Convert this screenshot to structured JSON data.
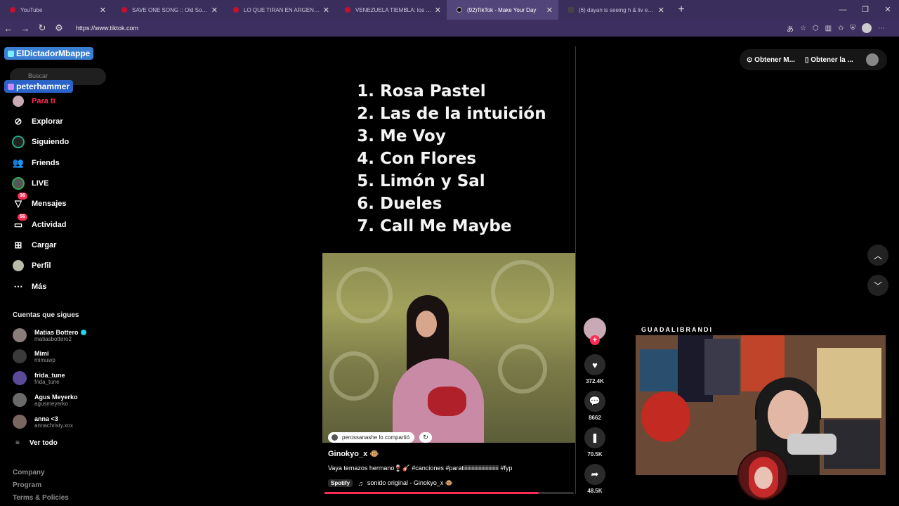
{
  "browser": {
    "tabs": [
      {
        "label": "YouTube",
        "active": false
      },
      {
        "label": "SAVE ONE SONG :: Old Song vs",
        "active": false
      },
      {
        "label": "LO QUE TIRAN EN ARGENTINA EN",
        "active": false
      },
      {
        "label": "VENEZUELA TIEMBLA: los héroes",
        "active": false
      },
      {
        "label": "(92)TikTok - Make Your Day",
        "active": true
      },
      {
        "label": "(6) dayan is seeing h & liv en X: \"h",
        "active": false
      }
    ],
    "url": "https://www.tiktok.com"
  },
  "overlay": {
    "user1": "ElDictadorMbappe",
    "user2": "peterhammer"
  },
  "search": {
    "placeholder": "Buscar"
  },
  "nav": [
    {
      "label": "Para ti",
      "icon": "home-icon"
    },
    {
      "label": "Explorar",
      "icon": "compass-icon"
    },
    {
      "label": "Siguiendo",
      "icon": "following-icon"
    },
    {
      "label": "Friends",
      "icon": "friends-icon"
    },
    {
      "label": "LIVE",
      "icon": "live-icon"
    },
    {
      "label": "Mensajes",
      "icon": "messages-icon",
      "badge": "36"
    },
    {
      "label": "Actividad",
      "icon": "activity-icon",
      "badge": "56"
    },
    {
      "label": "Cargar",
      "icon": "upload-icon"
    },
    {
      "label": "Perfil",
      "icon": "profile-icon"
    },
    {
      "label": "Más",
      "icon": "more-icon"
    }
  ],
  "following": {
    "title": "Cuentas que sigues",
    "accounts": [
      {
        "name": "Matias Bottero",
        "handle": "matiasbottero2",
        "verified": true
      },
      {
        "name": "Mimi",
        "handle": "mimuwp"
      },
      {
        "name": "frida_tune",
        "handle": "frida_tune"
      },
      {
        "name": "Agus Meyerko",
        "handle": "agusmeyerko"
      },
      {
        "name": "anna <3",
        "handle": "annachristy.xox"
      }
    ],
    "see_all": "Ver todo"
  },
  "footer": [
    "Company",
    "Program",
    "Terms & Policies"
  ],
  "video": {
    "songs": [
      {
        "n": "1.",
        "title": "Rosa Pastel"
      },
      {
        "n": "2.",
        "title": "Las de la intuición"
      },
      {
        "n": "3.",
        "title": "Me Voy"
      },
      {
        "n": "4.",
        "title": "Con Flores"
      },
      {
        "n": "5.",
        "title": "Limón y Sal"
      },
      {
        "n": "6.",
        "title": "Dueles"
      },
      {
        "n": "7.",
        "title": "Call Me Maybe"
      }
    ],
    "shared_by": "perossanashe lo compartió",
    "author": "Ginokyo_x 🐵",
    "caption": "Vaya temazos hermano🍷🎸 #canciones #paratiiiiiiiiiiiiiiiiiiiiiiiii #fyp",
    "spotify": "Spotify",
    "sound": "sonido original - Ginokyo_x 🐵",
    "progress": 0.86
  },
  "actions": {
    "likes": "372.4K",
    "comments": "8662",
    "saves": "70.5K",
    "shares": "48.5K"
  },
  "topbar": {
    "coins": "Obtener M...",
    "app": "Obtener la ..."
  },
  "stream": {
    "name": "GUADALIBRANDI"
  },
  "colors": {
    "accent": "#fe2c55",
    "tabbar": "#3a2e5c"
  }
}
